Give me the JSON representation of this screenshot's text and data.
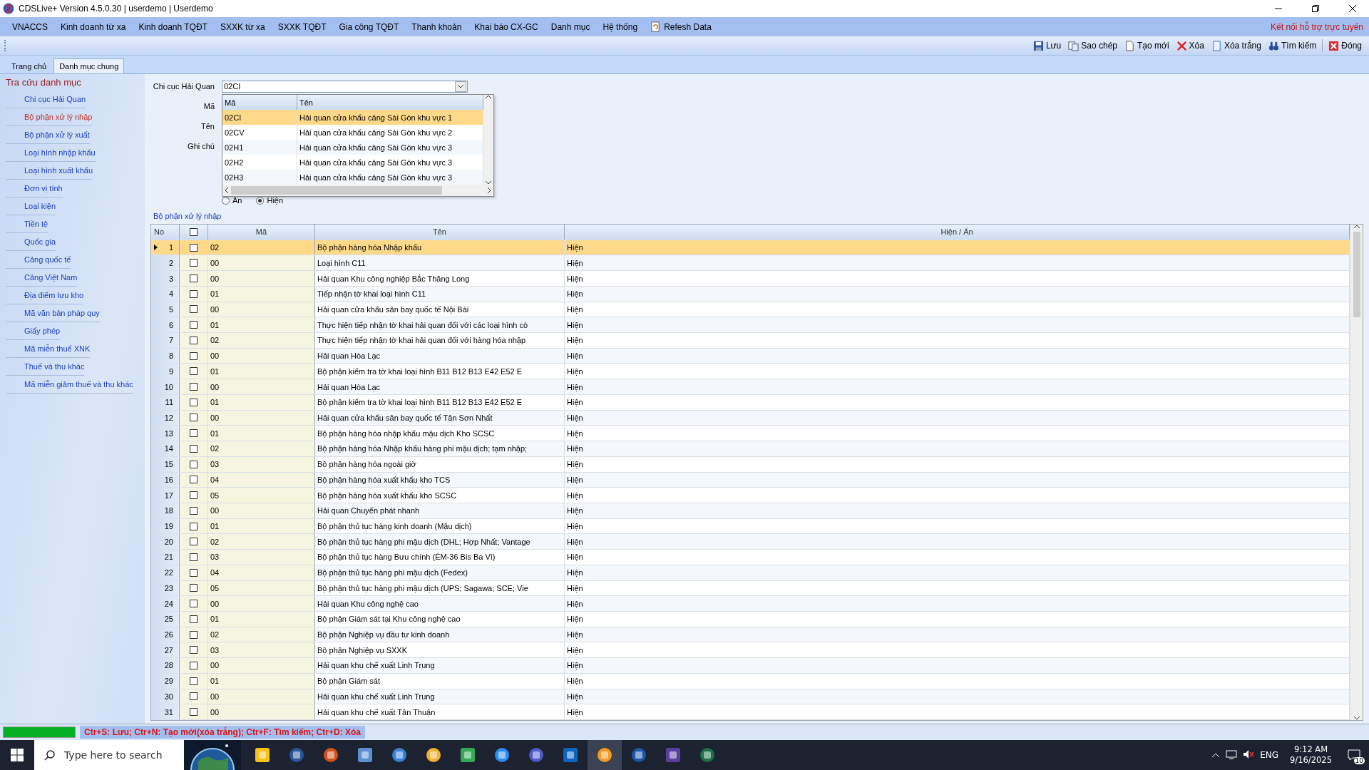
{
  "window": {
    "title": "CDSLive+ Version 4.5.0.30 | userdemo | Userdemo"
  },
  "menu": [
    {
      "label": "VNACCS"
    },
    {
      "label": "Kinh doanh từ xa"
    },
    {
      "label": "Kinh doanh TQĐT"
    },
    {
      "label": "SXXK từ xa"
    },
    {
      "label": "SXXK TQĐT"
    },
    {
      "label": "Gia công TQĐT"
    },
    {
      "label": "Thanh khoản"
    },
    {
      "label": "Khai báo CX-GC"
    },
    {
      "label": "Danh mục"
    },
    {
      "label": "Hệ thống"
    },
    {
      "label": "Refesh Data",
      "kind": "refresh"
    }
  ],
  "support_link": "Kết nối hỗ trợ trực tuyến",
  "toolbar": [
    {
      "label": "Lưu",
      "kind": "save"
    },
    {
      "label": "Sao chép",
      "kind": "copy"
    },
    {
      "label": "Tạo mới",
      "kind": "new"
    },
    {
      "label": "Xóa",
      "kind": "delete"
    },
    {
      "label": "Xóa trắng",
      "kind": "clear"
    },
    {
      "label": "Tìm kiếm",
      "kind": "search"
    },
    {
      "label": "Đóng",
      "kind": "close"
    }
  ],
  "tabs": [
    {
      "label": "Trang chủ",
      "selected": false
    },
    {
      "label": "Danh mục chung",
      "selected": true
    }
  ],
  "sidebar": {
    "title": "Tra cứu danh mục",
    "items": [
      {
        "label": "Chi cục Hải Quan",
        "selected": false
      },
      {
        "label": "Bộ phận xử lý nhập",
        "selected": true
      },
      {
        "label": "Bộ phận xử lý xuất",
        "selected": false
      },
      {
        "label": "Loại hình nhập khẩu",
        "selected": false
      },
      {
        "label": "Loại hình xuất khẩu",
        "selected": false
      },
      {
        "label": "Đơn vị tính",
        "selected": false
      },
      {
        "label": "Loại kiện",
        "selected": false
      },
      {
        "label": "Tiền tệ",
        "selected": false
      },
      {
        "label": "Quốc gia",
        "selected": false
      },
      {
        "label": "Cảng quốc tế",
        "selected": false
      },
      {
        "label": "Cảng Việt Nam",
        "selected": false
      },
      {
        "label": "Địa điểm lưu kho",
        "selected": false
      },
      {
        "label": "Mã văn bản pháp quy",
        "selected": false
      },
      {
        "label": "Giấy phép",
        "selected": false
      },
      {
        "label": "Mã miễn thuế XNK",
        "selected": false
      },
      {
        "label": "Thuế và thu khác",
        "selected": false
      },
      {
        "label": "Mã miễn giảm thuế và thu khác",
        "selected": false
      }
    ]
  },
  "form": {
    "labels": [
      "Chi cục Hải Quan",
      "Mã",
      "Tên",
      "Ghi chú"
    ],
    "combo_value": "02CI",
    "radios": [
      {
        "label": "Ẩn",
        "selected": false
      },
      {
        "label": "Hiện",
        "selected": true
      }
    ],
    "dropdown": {
      "columns": [
        "Mã",
        "Tên"
      ],
      "rows": [
        {
          "code": "02CI",
          "name": "Hải quan cửa khẩu cảng Sài Gòn khu vực 1",
          "selected": true
        },
        {
          "code": "02CV",
          "name": "Hải quan cửa khẩu cảng Sài Gòn khu vực 2",
          "selected": false
        },
        {
          "code": "02H1",
          "name": "Hải quan cửa khẩu cảng Sài Gòn khu vực 3",
          "selected": false
        },
        {
          "code": "02H2",
          "name": "Hải quan cửa khẩu cảng Sài Gòn khu vực 3",
          "selected": false
        },
        {
          "code": "02H3",
          "name": "Hải quan cửa khẩu cảng Sài Gòn khu vực 3",
          "selected": false
        }
      ]
    }
  },
  "grid": {
    "title": "Bộ phận xử lý nhập",
    "columns": [
      "No",
      "Mã",
      "Tên",
      "Hiện / Ẩn"
    ],
    "header_checked": false,
    "rows": [
      {
        "no": "1",
        "checked": false,
        "code": "02",
        "name": "Bộ phận hàng hóa Nhập khẩu",
        "status": "Hiện",
        "selected": true
      },
      {
        "no": "2",
        "checked": false,
        "code": "00",
        "name": "Loại hình C11",
        "status": "Hiện",
        "selected": false
      },
      {
        "no": "3",
        "checked": false,
        "code": "00",
        "name": "Hải quan Khu công nghiệp Bắc Thăng Long",
        "status": "Hiện",
        "selected": false
      },
      {
        "no": "4",
        "checked": false,
        "code": "01",
        "name": "Tiếp nhận tờ khai loại hình C11",
        "status": "Hiện",
        "selected": false
      },
      {
        "no": "5",
        "checked": false,
        "code": "00",
        "name": "Hải quan cửa khẩu sân bay quốc tế Nội Bài",
        "status": "Hiện",
        "selected": false
      },
      {
        "no": "6",
        "checked": false,
        "code": "01",
        "name": "Thực hiện tiếp nhận tờ khai hải quan đối với các loại hình cò",
        "status": "Hiện",
        "selected": false
      },
      {
        "no": "7",
        "checked": false,
        "code": "02",
        "name": "Thực hiện tiếp nhận tờ khai hải quan đối với hàng hóa nhập",
        "status": "Hiện",
        "selected": false
      },
      {
        "no": "8",
        "checked": false,
        "code": "00",
        "name": "Hải quan Hòa Lạc",
        "status": "Hiện",
        "selected": false
      },
      {
        "no": "9",
        "checked": false,
        "code": "01",
        "name": "Bộ phận kiểm tra tờ khai loại hình B11 B12 B13 E42 E52 E",
        "status": "Hiện",
        "selected": false
      },
      {
        "no": "10",
        "checked": false,
        "code": "00",
        "name": "Hải quan Hòa Lạc",
        "status": "Hiện",
        "selected": false
      },
      {
        "no": "11",
        "checked": false,
        "code": "01",
        "name": "Bộ phận kiểm tra tờ khai loại hình B11 B12 B13 E42 E52 E",
        "status": "Hiện",
        "selected": false
      },
      {
        "no": "12",
        "checked": false,
        "code": "00",
        "name": "Hải quan cửa khẩu sân bay quốc tế Tân Sơn Nhất",
        "status": "Hiện",
        "selected": false
      },
      {
        "no": "13",
        "checked": false,
        "code": "01",
        "name": "Bộ phận hàng hóa nhập khẩu mậu dịch Kho SCSC",
        "status": "Hiện",
        "selected": false
      },
      {
        "no": "14",
        "checked": false,
        "code": "02",
        "name": "Bộ phận hàng hóa Nhập khẩu hàng phi mậu dịch; tạm nhập;",
        "status": "Hiện",
        "selected": false
      },
      {
        "no": "15",
        "checked": false,
        "code": "03",
        "name": "Bộ phận hàng hóa ngoài giờ",
        "status": "Hiện",
        "selected": false
      },
      {
        "no": "16",
        "checked": false,
        "code": "04",
        "name": "Bộ phận hàng hóa xuất khẩu kho TCS",
        "status": "Hiện",
        "selected": false
      },
      {
        "no": "17",
        "checked": false,
        "code": "05",
        "name": "Bộ phận hàng hóa xuất khẩu kho SCSC",
        "status": "Hiện",
        "selected": false
      },
      {
        "no": "18",
        "checked": false,
        "code": "00",
        "name": "Hải quan Chuyển phát nhanh",
        "status": "Hiện",
        "selected": false
      },
      {
        "no": "19",
        "checked": false,
        "code": "01",
        "name": "Bộ phận thủ tục hàng kinh doanh (Mậu dịch)",
        "status": "Hiện",
        "selected": false
      },
      {
        "no": "20",
        "checked": false,
        "code": "02",
        "name": "Bộ phận thủ tục hàng phi mậu dịch (DHL; Hợp Nhất; Vantage",
        "status": "Hiện",
        "selected": false
      },
      {
        "no": "21",
        "checked": false,
        "code": "03",
        "name": "Bộ phận thủ tục hàng Bưu chính (ÉM-36 Bis Ba Vì)",
        "status": "Hiện",
        "selected": false
      },
      {
        "no": "22",
        "checked": false,
        "code": "04",
        "name": "Bộ phận thủ tục hàng phi mậu dịch (Fedex)",
        "status": "Hiện",
        "selected": false
      },
      {
        "no": "23",
        "checked": false,
        "code": "05",
        "name": "Bộ phận thủ tục hàng phi mậu dịch (UPS; Sagawa; SCE; Vie",
        "status": "Hiện",
        "selected": false
      },
      {
        "no": "24",
        "checked": false,
        "code": "00",
        "name": "Hải quan Khu công nghệ cao",
        "status": "Hiện",
        "selected": false
      },
      {
        "no": "25",
        "checked": false,
        "code": "01",
        "name": "Bộ phận Giám sát tại Khu công nghệ cao",
        "status": "Hiện",
        "selected": false
      },
      {
        "no": "26",
        "checked": false,
        "code": "02",
        "name": "Bộ phận Nghiệp vụ đầu tư kinh doanh",
        "status": "Hiện",
        "selected": false
      },
      {
        "no": "27",
        "checked": false,
        "code": "03",
        "name": "Bộ phận Nghiệp vụ SXXK",
        "status": "Hiện",
        "selected": false
      },
      {
        "no": "28",
        "checked": false,
        "code": "00",
        "name": "Hải quan khu chế xuất Linh Trung",
        "status": "Hiện",
        "selected": false
      },
      {
        "no": "29",
        "checked": false,
        "code": "01",
        "name": "Bộ phận Giám sát",
        "status": "Hiện",
        "selected": false
      },
      {
        "no": "30",
        "checked": false,
        "code": "00",
        "name": "Hải quan khu chế xuất Linh Trung",
        "status": "Hiện",
        "selected": false
      },
      {
        "no": "31",
        "checked": false,
        "code": "00",
        "name": "Hải quan khu chế xuất Tân Thuận",
        "status": "Hiện",
        "selected": false
      }
    ]
  },
  "status_bar": {
    "level": 1,
    "text": "Ctr+S: Lưu; Ctr+N: Tạo mới(xóa trắng); Ctr+F: Tìm kiếm; Ctr+D: Xóa"
  },
  "taskbar": {
    "search_placeholder": "Type here to search",
    "language": "ENG",
    "time": "9:12 AM",
    "date": "9/16/2025",
    "notifications": "10"
  }
}
